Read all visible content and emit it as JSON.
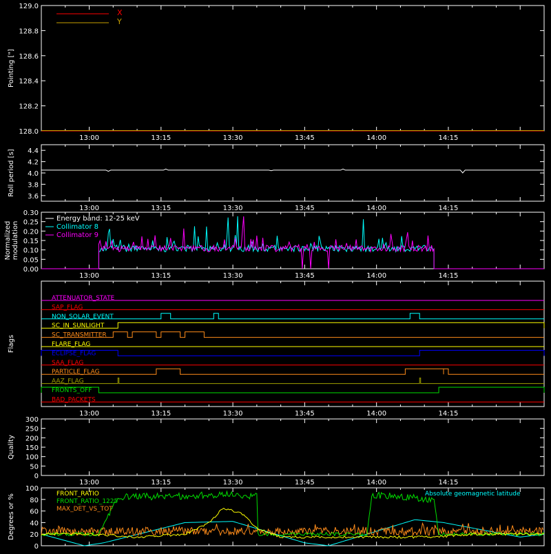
{
  "palette": {
    "background": "#000000",
    "axes": "#ffffff",
    "x_series": "#ff0000",
    "y_series": "#c8a000",
    "cyan": "#00ffff",
    "magenta": "#ff00ff",
    "green": "#00e000",
    "orange": "#ff8c1a",
    "yellow": "#ffff00",
    "blue": "#0000ff",
    "red": "#ff0000",
    "olive": "#a0a000"
  },
  "time_ticks": [
    "13:00",
    "13:15",
    "13:30",
    "13:45",
    "14:00",
    "14:15"
  ],
  "chart_data": [
    {
      "id": "pointing",
      "type": "line",
      "ylabel": "Pointing [\"]",
      "ylim": [
        128.0,
        129.0
      ],
      "yticks": [
        "128.0",
        "128.2",
        "128.4",
        "128.6",
        "128.8",
        "129.0"
      ],
      "legend": [
        "X",
        "Y"
      ],
      "legend_placement": "top-left",
      "series": [
        {
          "name": "X",
          "color": "#ff0000",
          "x": [
            "12:50",
            "14:35"
          ],
          "y": [
            128.0,
            128.0
          ]
        },
        {
          "name": "Y",
          "color": "#c8a000",
          "x": [
            "12:50",
            "14:35"
          ],
          "y": [
            128.0,
            128.0
          ]
        }
      ]
    },
    {
      "id": "roll",
      "type": "line",
      "ylabel": "Roll period [s]",
      "ylim": [
        3.5,
        4.5
      ],
      "yticks": [
        "3.6",
        "3.8",
        "4.0",
        "4.2",
        "4.4"
      ],
      "series": [
        {
          "color": "#ffffff",
          "x": [
            "12:50",
            "14:35"
          ],
          "y": [
            4.05,
            4.05
          ]
        }
      ]
    },
    {
      "id": "modulation",
      "type": "line",
      "ylabel": "Normalized\nmodulation",
      "ylim": [
        0.0,
        0.3
      ],
      "yticks": [
        "0.00",
        "0.05",
        "0.10",
        "0.15",
        "0.20",
        "0.25",
        "0.30"
      ],
      "legend": [
        "Energy band: 12-25 keV",
        "Collimator 8",
        "Collimator 9"
      ],
      "legend_placement": "top-left",
      "active_interval": [
        "13:02",
        "14:12"
      ],
      "series": [
        {
          "name": "Collimator 8",
          "color": "#00ffff",
          "baseline": 0.1,
          "peak": 0.28
        },
        {
          "name": "Collimator 9",
          "color": "#ff00ff",
          "baseline": 0.1,
          "peak": 0.3
        }
      ]
    },
    {
      "id": "flags",
      "type": "line",
      "ylabel": "Flags",
      "series": [
        {
          "name": "ATTENUATOR_STATE",
          "color": "#ff00ff",
          "segments": []
        },
        {
          "name": "SAP_FLAG",
          "color": "#ff0000",
          "segments": []
        },
        {
          "name": "NON_SOLAR_EVENT",
          "color": "#00ffff",
          "segments": [
            [
              "13:15",
              "13:17"
            ],
            [
              "13:26",
              "13:27"
            ],
            [
              "14:07",
              "14:09"
            ]
          ]
        },
        {
          "name": "SC_IN_SUNLIGHT",
          "color": "#ffff00",
          "segments": [
            [
              "13:06",
              "14:35"
            ]
          ]
        },
        {
          "name": "SC_TRANSMITTER",
          "color": "#ff8c1a",
          "segments": [
            [
              "13:05",
              "13:08"
            ],
            [
              "13:09",
              "13:14"
            ],
            [
              "13:15",
              "13:19"
            ],
            [
              "13:20",
              "13:24"
            ]
          ]
        },
        {
          "name": "FLARE_FLAG",
          "color": "#ffff00",
          "segments": []
        },
        {
          "name": "ECLIPSE_FLAG",
          "color": "#0000ff",
          "segments": [
            [
              "12:50",
              "13:06"
            ],
            [
              "14:09",
              "14:35"
            ]
          ]
        },
        {
          "name": "SAA_FLAG",
          "color": "#ff0000",
          "segments": []
        },
        {
          "name": "PARTICLE_FLAG",
          "color": "#ff8c1a",
          "segments": [
            [
              "13:14",
              "13:19"
            ],
            [
              "14:06",
              "14:14"
            ],
            [
              "14:14",
              "14:15"
            ]
          ]
        },
        {
          "name": "AAZ_FLAG",
          "color": "#a0a000",
          "segments": [
            [
              "13:06",
              "13:06"
            ],
            [
              "14:09",
              "14:09"
            ]
          ]
        },
        {
          "name": "FRONTS_OFF",
          "color": "#00e000",
          "segments": [
            [
              "12:50",
              "13:02"
            ],
            [
              "14:13",
              "14:35"
            ]
          ]
        },
        {
          "name": "BAD_PACKETS",
          "color": "#ff0000",
          "segments": []
        }
      ]
    },
    {
      "id": "quality",
      "type": "line",
      "ylabel": "Quality",
      "ylim": [
        0,
        300
      ],
      "yticks": [
        "0",
        "50",
        "100",
        "150",
        "200",
        "250",
        "300"
      ],
      "series": []
    },
    {
      "id": "ratios",
      "type": "line",
      "ylabel": "Degrees or %",
      "ylim": [
        0,
        100
      ],
      "yticks": [
        "0",
        "20",
        "40",
        "60",
        "80",
        "100"
      ],
      "legend": [
        "FRONT_RATIO",
        "FRONT_RATIO_1225",
        "MAX_DET_VS_TOT",
        "Absolute geomagnetic latitude"
      ],
      "legend_placement": "top-left",
      "series": [
        {
          "name": "FRONT_RATIO",
          "color": "#ffff00",
          "points": [
            [
              "12:50",
              20
            ],
            [
              "13:00",
              20
            ],
            [
              "13:10",
              15
            ],
            [
              "13:20",
              20
            ],
            [
              "13:25",
              40
            ],
            [
              "13:28",
              65
            ],
            [
              "13:32",
              55
            ],
            [
              "13:35",
              30
            ],
            [
              "13:40",
              15
            ],
            [
              "14:00",
              15
            ],
            [
              "14:12",
              15
            ],
            [
              "14:20",
              20
            ],
            [
              "14:35",
              20
            ]
          ]
        },
        {
          "name": "FRONT_RATIO_1225",
          "color": "#00e000",
          "points": [
            [
              "12:50",
              20
            ],
            [
              "13:02",
              20
            ],
            [
              "13:06",
              85
            ],
            [
              "13:20",
              85
            ],
            [
              "13:30",
              90
            ],
            [
              "13:35",
              85
            ],
            [
              "13:35",
              20
            ],
            [
              "13:58",
              20
            ],
            [
              "13:59",
              88
            ],
            [
              "14:12",
              80
            ],
            [
              "14:13",
              20
            ],
            [
              "14:35",
              20
            ]
          ]
        },
        {
          "name": "MAX_DET_VS_TOT",
          "color": "#ff8c1a",
          "mean": 25
        },
        {
          "name": "Absolute geomagnetic latitude",
          "color": "#00ffff",
          "points": [
            [
              "12:50",
              20
            ],
            [
              "12:59",
              0
            ],
            [
              "13:03",
              5
            ],
            [
              "13:20",
              40
            ],
            [
              "13:30",
              42
            ],
            [
              "13:45",
              5
            ],
            [
              "13:50",
              0
            ],
            [
              "14:08",
              45
            ],
            [
              "14:14",
              40
            ],
            [
              "14:30",
              15
            ],
            [
              "14:35",
              20
            ]
          ]
        }
      ]
    }
  ]
}
